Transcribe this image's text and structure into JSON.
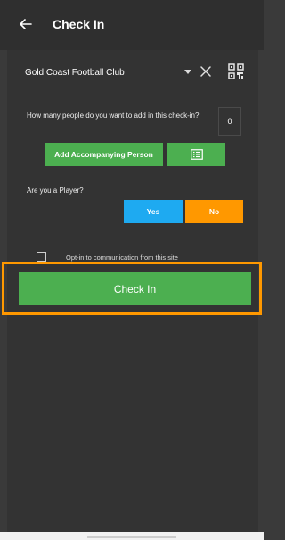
{
  "header": {
    "title": "Check In"
  },
  "club": {
    "name": "Gold Coast Football Club"
  },
  "people": {
    "question": "How many people do you want to add in this check-in?",
    "value": "0",
    "add_label": "Add Accompanying Person"
  },
  "player": {
    "question": "Are you a Player?",
    "yes_label": "Yes",
    "no_label": "No"
  },
  "optin": {
    "label": "Opt-in to communication from this site",
    "checked": false
  },
  "checkin": {
    "label": "Check In"
  },
  "colors": {
    "green": "#4caf50",
    "blue": "#1eaaf1",
    "orange": "#ff9800",
    "highlight": "#ff9800"
  },
  "icons": [
    "arrow-left-icon",
    "chevron-down-icon",
    "close-icon",
    "qr-code-icon",
    "list-icon",
    "checkbox-icon"
  ]
}
